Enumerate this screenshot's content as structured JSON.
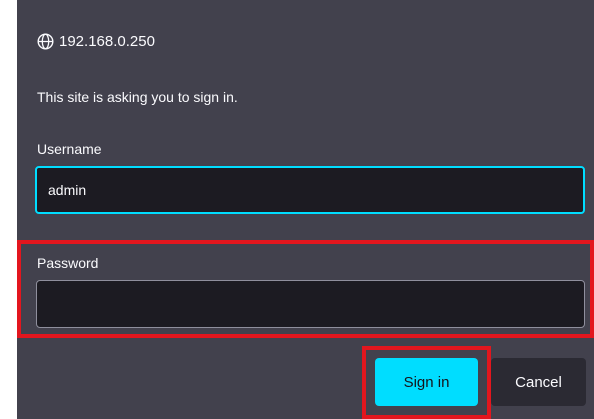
{
  "dialog": {
    "origin": "192.168.0.250",
    "origin_icon": "globe-icon",
    "message": "This site is asking you to sign in.",
    "username_label": "Username",
    "username_value": "admin",
    "password_label": "Password",
    "password_value": "",
    "signin_label": "Sign in",
    "cancel_label": "Cancel"
  },
  "colors": {
    "background": "#42414d",
    "input_background": "#1c1b22",
    "accent": "#00ddff",
    "highlight": "#e3161e",
    "cancel_background": "#2b2a33",
    "text": "#fbfbfe"
  }
}
